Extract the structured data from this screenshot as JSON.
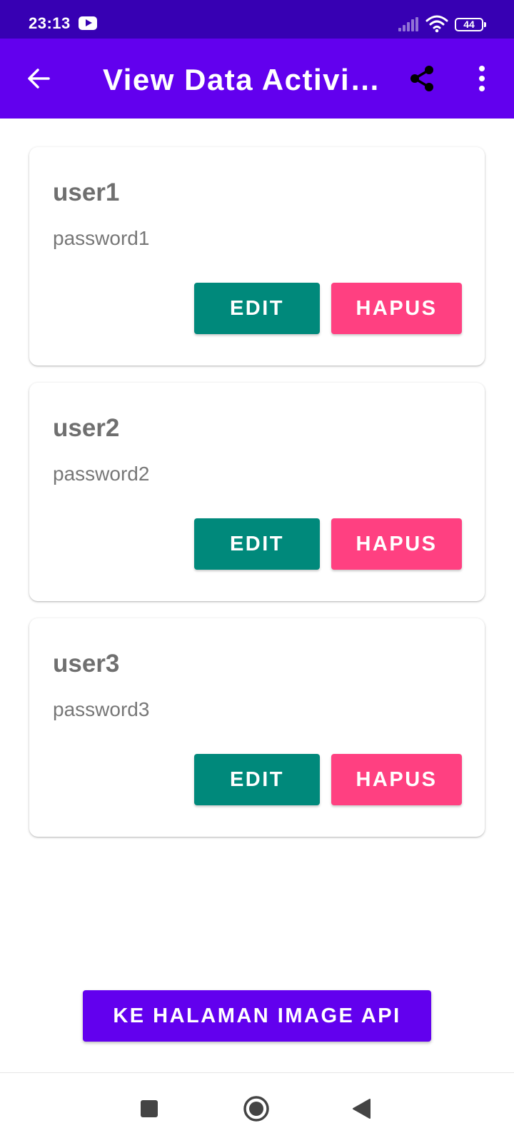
{
  "status_bar": {
    "time": "23:13",
    "battery": "44",
    "icons": [
      "youtube-notification-icon",
      "signal-icon",
      "wifi-icon",
      "battery-icon"
    ]
  },
  "app_bar": {
    "title": "View Data Activi…",
    "icons": [
      "back-arrow-icon",
      "share-icon",
      "more-vert-icon"
    ],
    "background": "#6200ee"
  },
  "users": [
    {
      "name": "user1",
      "password": "password1",
      "edit_label": "EDIT",
      "delete_label": "HAPUS"
    },
    {
      "name": "user2",
      "password": "password2",
      "edit_label": "EDIT",
      "delete_label": "HAPUS"
    },
    {
      "name": "user3",
      "password": "password3",
      "edit_label": "EDIT",
      "delete_label": "HAPUS"
    }
  ],
  "bottom_button": {
    "label": "KE HALAMAN IMAGE API"
  },
  "nav_bar": {
    "icons": [
      "recents-square-icon",
      "home-circle-icon",
      "back-triangle-icon"
    ]
  },
  "colors": {
    "status_bar": "#3700b3",
    "primary": "#6200ee",
    "edit_button": "#00897b",
    "delete_button": "#ff4081"
  }
}
